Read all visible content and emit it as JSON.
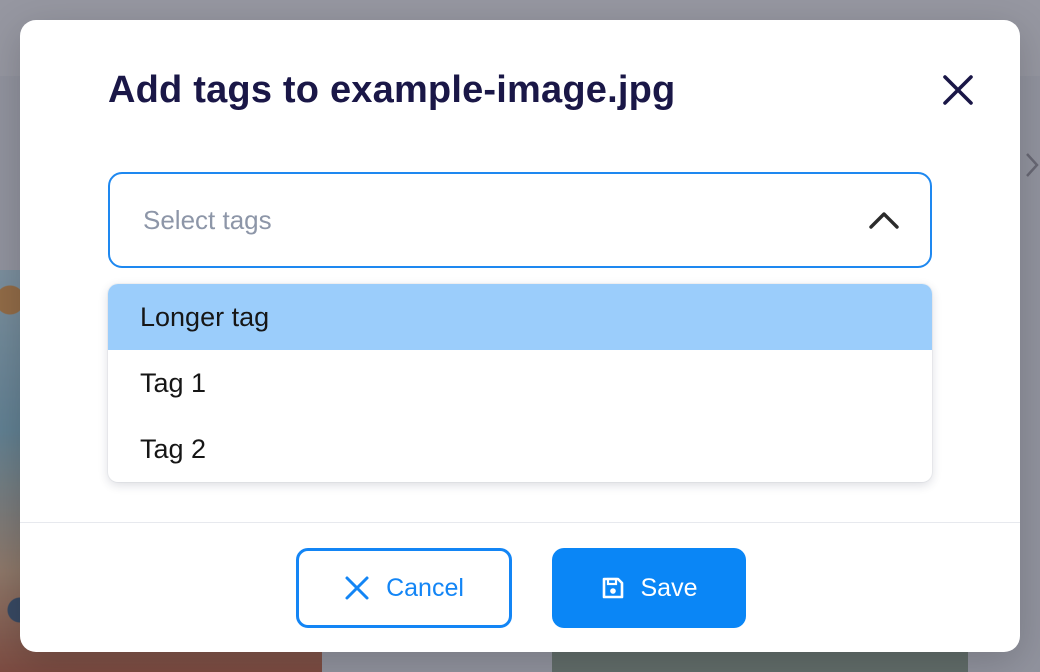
{
  "modal": {
    "title": "Add tags to example-image.jpg"
  },
  "tag_select": {
    "placeholder": "Select tags",
    "expanded": true,
    "options": [
      {
        "label": "Longer tag",
        "highlighted": true
      },
      {
        "label": "Tag 1",
        "highlighted": false
      },
      {
        "label": "Tag 2",
        "highlighted": false
      }
    ]
  },
  "footer": {
    "cancel_label": "Cancel",
    "save_label": "Save"
  },
  "icons": {
    "close": "close-icon",
    "chevron": "chevron-up-icon",
    "cancel": "x-icon",
    "save": "floppy-disk-icon"
  },
  "colors": {
    "title": "#1a1747",
    "accent": "#1385f5",
    "highlight": "#9bcdfb",
    "placeholder": "#8d96a8"
  }
}
